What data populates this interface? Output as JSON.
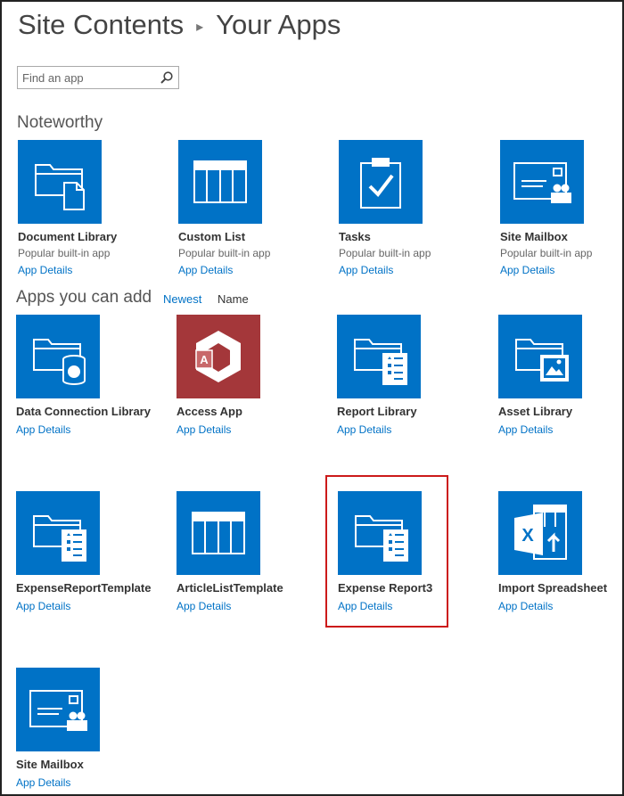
{
  "header": {
    "breadcrumb_root": "Site Contents",
    "breadcrumb_current": "Your Apps"
  },
  "search": {
    "placeholder": "Find an app"
  },
  "sections": {
    "noteworthy": "Noteworthy",
    "apps_you_can_add": "Apps you can add"
  },
  "sort": {
    "newest": "Newest",
    "name": "Name"
  },
  "noteworthy_tiles": [
    {
      "name": "Document Library",
      "subtitle": "Popular built-in app",
      "details": "App Details",
      "icon": "document-library-icon"
    },
    {
      "name": "Custom List",
      "subtitle": "Popular built-in app",
      "details": "App Details",
      "icon": "custom-list-icon"
    },
    {
      "name": "Tasks",
      "subtitle": "Popular built-in app",
      "details": "App Details",
      "icon": "tasks-icon"
    },
    {
      "name": "Site Mailbox",
      "subtitle": "Popular built-in app",
      "details": "App Details",
      "icon": "site-mailbox-icon"
    }
  ],
  "app_tiles": [
    {
      "name": "Data Connection Library",
      "details": "App Details",
      "icon": "data-connection-library-icon"
    },
    {
      "name": "Access App",
      "details": "App Details",
      "icon": "access-app-icon"
    },
    {
      "name": "Report Library",
      "details": "App Details",
      "icon": "report-library-icon"
    },
    {
      "name": "Asset Library",
      "details": "App Details",
      "icon": "asset-library-icon"
    },
    {
      "name": "ExpenseReportTemplate",
      "details": "App Details",
      "icon": "report-library-icon"
    },
    {
      "name": "ArticleListTemplate",
      "details": "App Details",
      "icon": "custom-list-icon"
    },
    {
      "name": "Expense Report3",
      "details": "App Details",
      "icon": "report-library-icon"
    },
    {
      "name": "Import Spreadsheet",
      "details": "App Details",
      "icon": "import-spreadsheet-icon"
    },
    {
      "name": "Site Mailbox",
      "details": "App Details",
      "icon": "site-mailbox-icon"
    }
  ],
  "colors": {
    "tile_blue": "#0072c6",
    "access_red": "#a4373a",
    "link_blue": "#0072c6",
    "highlight_red": "#cc1a1a"
  }
}
